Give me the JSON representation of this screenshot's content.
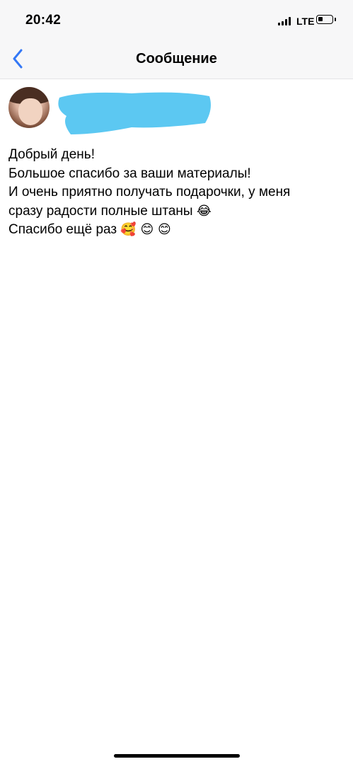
{
  "status_bar": {
    "time": "20:42",
    "network": "LTE",
    "signal_bars": 4,
    "battery_level": 0.3
  },
  "nav": {
    "back_icon": "chevron-left-icon",
    "title": "Сообщение",
    "accent_color": "#3478f6"
  },
  "sender": {
    "avatar_icon": "user-avatar",
    "name_redacted": true,
    "redaction_color": "#5cc8f2"
  },
  "message": {
    "lines": [
      "Добрый день!",
      "Большое спасибо за ваши материалы!",
      "И очень приятно получать подарочки, у меня",
      "сразу радости полные штаны",
      "Спасибо ещё раз"
    ],
    "emoji_line4": "😂",
    "emoji_line5": "🥰 😊 😊"
  }
}
